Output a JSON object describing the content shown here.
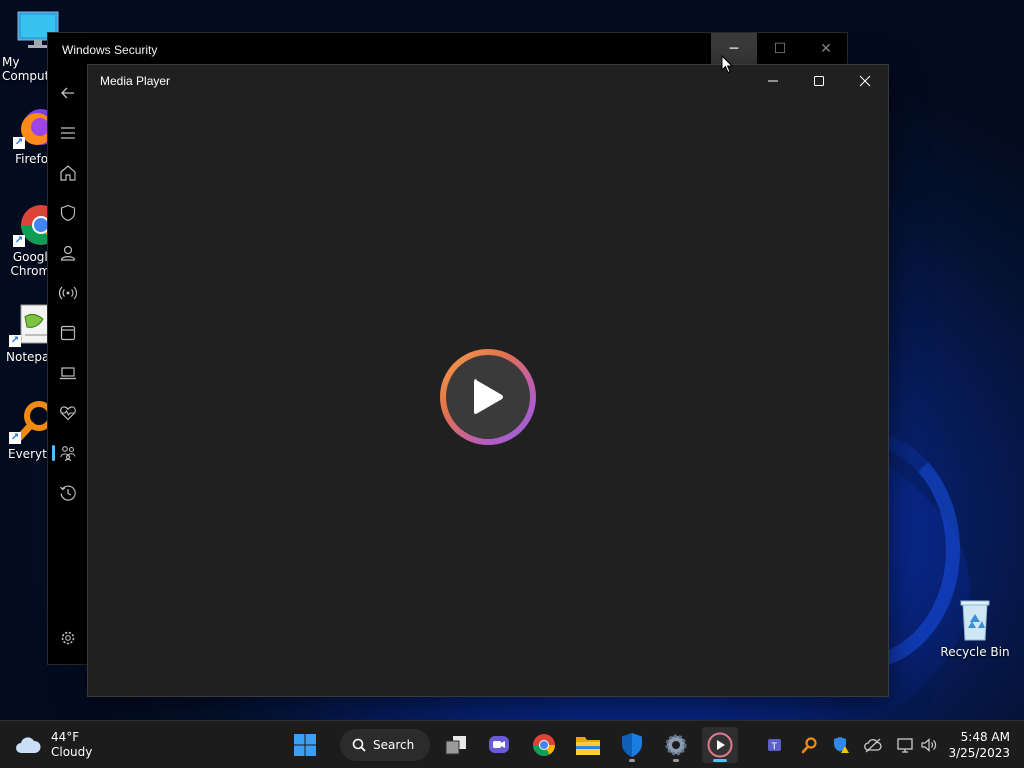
{
  "desktop": {
    "icons": [
      {
        "label": "My Computer",
        "name": "my-computer"
      },
      {
        "label": "Firefox",
        "name": "firefox"
      },
      {
        "label": "Google Chrome",
        "name": "google-chrome"
      },
      {
        "label": "Notepad++",
        "name": "notepad-plus-plus"
      },
      {
        "label": "Everything",
        "name": "everything"
      },
      {
        "label": "Recycle Bin",
        "name": "recycle-bin"
      }
    ]
  },
  "security_window": {
    "title": "Windows Security",
    "controls": {
      "minimize": "─",
      "maximize": "☐",
      "close": "✕"
    },
    "nav": [
      {
        "name": "back-icon"
      },
      {
        "name": "hamburger-menu-icon"
      },
      {
        "name": "home-icon"
      },
      {
        "name": "shield-icon"
      },
      {
        "name": "account-person-icon"
      },
      {
        "name": "wireless-network-icon"
      },
      {
        "name": "app-browser-window-icon"
      },
      {
        "name": "device-laptop-icon"
      },
      {
        "name": "health-heartbeat-icon"
      },
      {
        "name": "family-icon",
        "selected": true
      },
      {
        "name": "history-icon"
      }
    ],
    "settings_icon": "gear-icon"
  },
  "media_player": {
    "title": "Media Player",
    "play_icon": "play-icon",
    "accent": "#e4724a"
  },
  "taskbar": {
    "weather": {
      "temp": "44°F",
      "condition": "Cloudy"
    },
    "search_label": "Search",
    "pinned": [
      {
        "name": "start-button"
      },
      {
        "name": "search-button"
      },
      {
        "name": "task-view-button"
      },
      {
        "name": "teams-chat-button"
      },
      {
        "name": "chrome-button"
      },
      {
        "name": "file-explorer-button"
      },
      {
        "name": "windows-security-button",
        "running": true
      },
      {
        "name": "settings-button",
        "running": true
      },
      {
        "name": "media-player-button",
        "running": true,
        "active": true
      }
    ],
    "tray": [
      "teams-icon",
      "everything-icon",
      "security-warning-icon",
      "onedrive-icon",
      "network-icon",
      "volume-icon"
    ],
    "clock": {
      "time": "5:48 AM",
      "date": "3/25/2023"
    }
  }
}
